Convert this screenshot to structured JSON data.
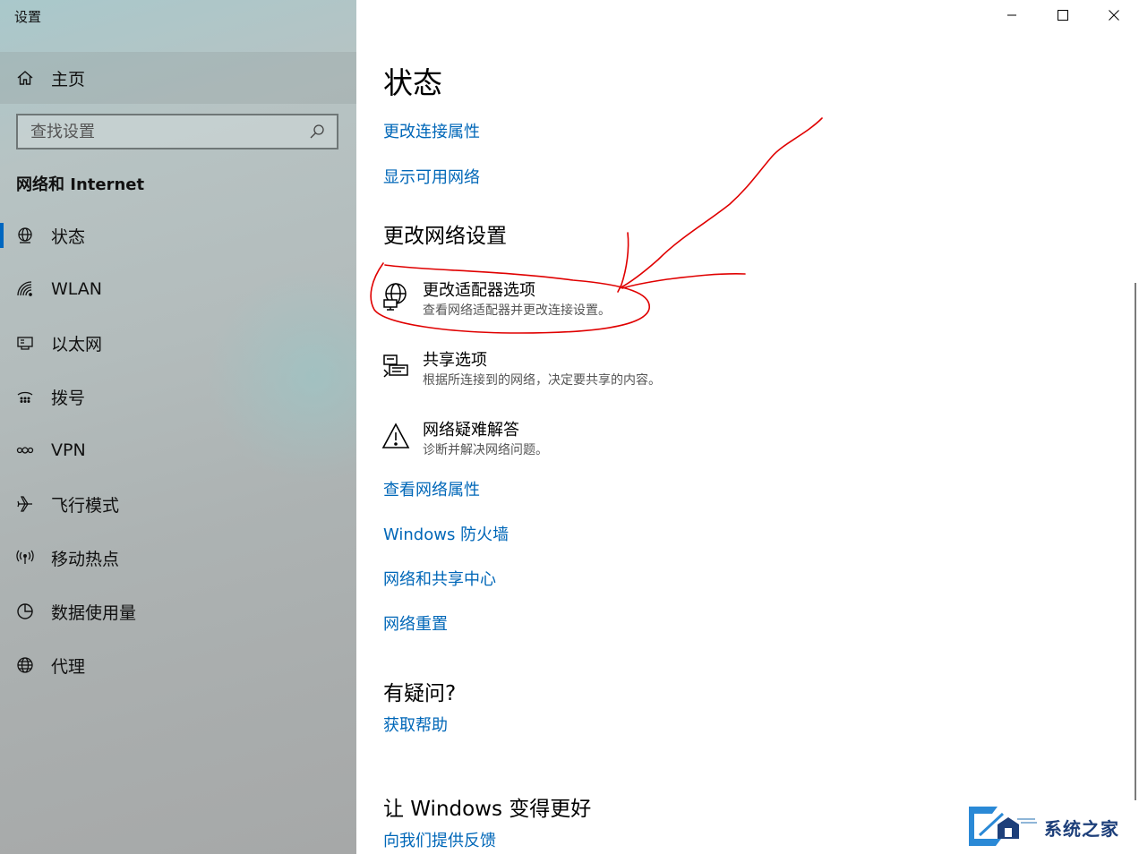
{
  "app": {
    "title": "设置"
  },
  "sidebar": {
    "home_label": "主页",
    "search_placeholder": "查找设置",
    "section_heading": "网络和 Internet",
    "items": [
      {
        "label": "状态",
        "icon": "globe-status-icon",
        "active": true
      },
      {
        "label": "WLAN",
        "icon": "wifi-icon"
      },
      {
        "label": "以太网",
        "icon": "ethernet-icon"
      },
      {
        "label": "拨号",
        "icon": "dialup-icon"
      },
      {
        "label": "VPN",
        "icon": "vpn-icon"
      },
      {
        "label": "飞行模式",
        "icon": "airplane-icon"
      },
      {
        "label": "移动热点",
        "icon": "hotspot-icon"
      },
      {
        "label": "数据使用量",
        "icon": "data-usage-icon"
      },
      {
        "label": "代理",
        "icon": "globe-icon"
      }
    ]
  },
  "main": {
    "title": "状态",
    "links_top": [
      "更改连接属性",
      "显示可用网络"
    ],
    "change_settings_heading": "更改网络设置",
    "options": [
      {
        "title": "更改适配器选项",
        "desc": "查看网络适配器并更改连接设置。",
        "icon": "adapter-icon"
      },
      {
        "title": "共享选项",
        "desc": "根据所连接到的网络，决定要共享的内容。",
        "icon": "sharing-icon"
      },
      {
        "title": "网络疑难解答",
        "desc": "诊断并解决网络问题。",
        "icon": "warning-icon"
      }
    ],
    "links_bottom": [
      "查看网络属性",
      "Windows 防火墙",
      "网络和共享中心",
      "网络重置"
    ],
    "question_heading": "有疑问?",
    "help_link": "获取帮助",
    "improve_heading": "让 Windows 变得更好",
    "feedback_link": "向我们提供反馈"
  },
  "watermark": {
    "text": "系统之家"
  },
  "colors": {
    "link": "#0067b8",
    "accent": "#0067c0",
    "annotation": "#e00000"
  }
}
